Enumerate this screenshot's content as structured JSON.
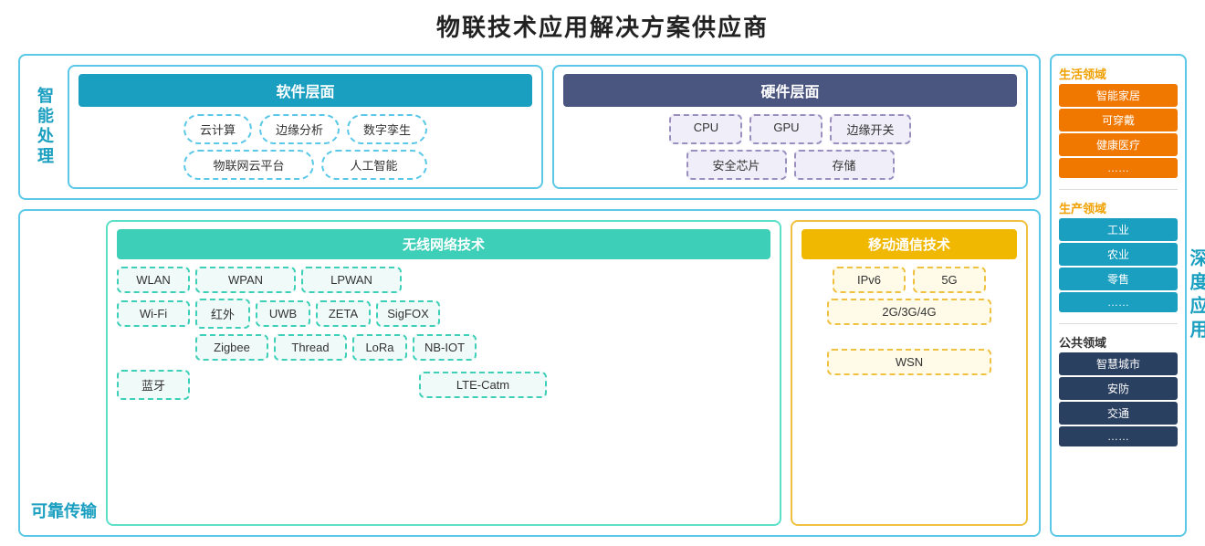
{
  "title": "物联技术应用解决方案供应商",
  "intel_label": "智能处理",
  "sw_header": "软件层面",
  "hw_header": "硬件层面",
  "sw_row1": [
    "云计算",
    "边缘分析",
    "数字孪生"
  ],
  "sw_row2": [
    "物联网云平台",
    "人工智能"
  ],
  "hw_row1": [
    "CPU",
    "GPU",
    "边缘开关"
  ],
  "hw_row2": [
    "安全芯片",
    "存储"
  ],
  "trans_label": "可靠传输",
  "wireless_header": "无线网络技术",
  "wireless_row1": [
    "WLAN",
    "WPAN",
    "LPWAN"
  ],
  "wireless_row2": [
    "Wi-Fi",
    "红外",
    "UWB",
    "ZETA",
    "SigFOX"
  ],
  "wireless_row3": [
    "Zigbee",
    "Thread",
    "LoRa",
    "NB-IOT"
  ],
  "wireless_row4": [
    "蓝牙",
    "LTE-Catm"
  ],
  "mobile_header": "移动通信技术",
  "mobile_row1": [
    "IPv6",
    "5G"
  ],
  "mobile_row2": [
    "2G/3G/4G"
  ],
  "mobile_row3": [
    "WSN"
  ],
  "right_domain1_title": "生活领域",
  "right_domain1_items": [
    "智能家居",
    "可穿戴",
    "健康医疗",
    "……"
  ],
  "right_domain2_title": "生产领域",
  "right_domain2_items": [
    "工业",
    "农业",
    "零售",
    "……"
  ],
  "right_domain3_title": "公共领域",
  "right_domain3_items": [
    "智慧城市",
    "安防",
    "交通",
    "……"
  ],
  "depth_label": "深度应用"
}
